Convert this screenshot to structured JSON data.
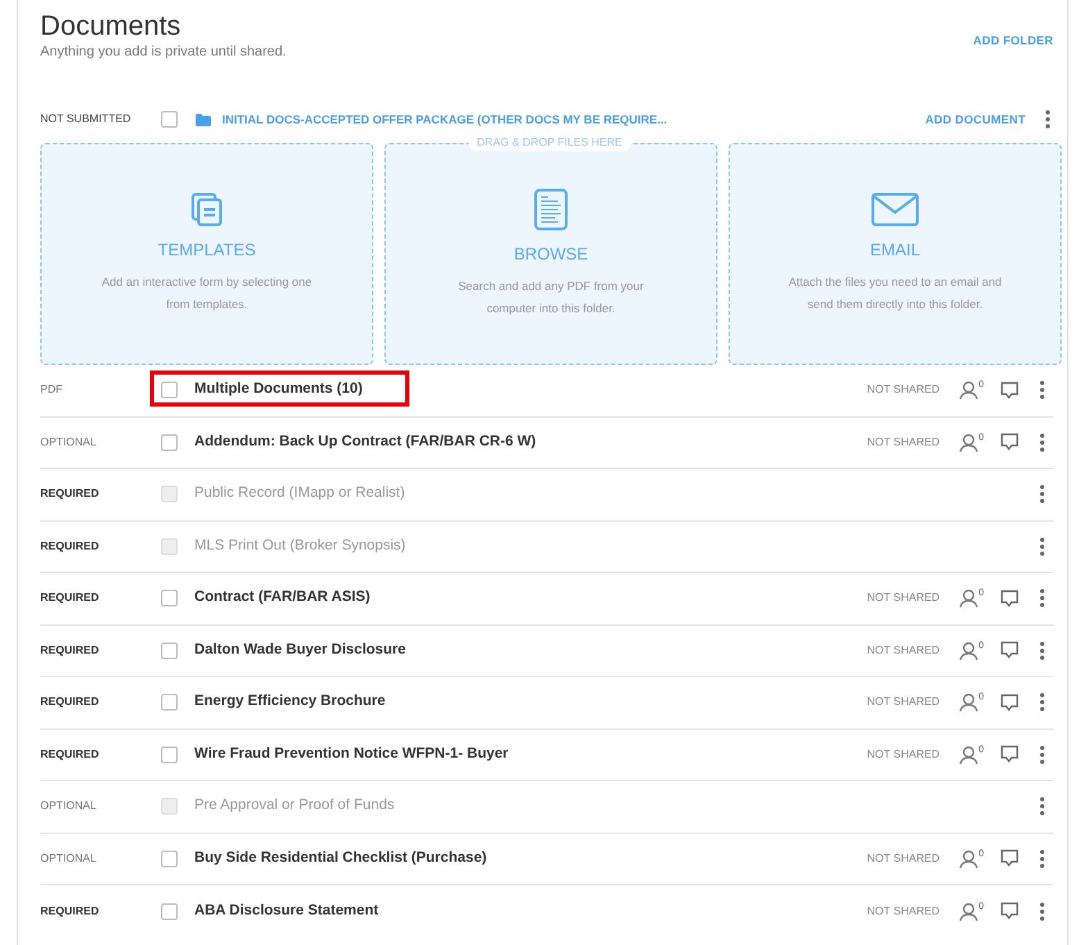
{
  "header": {
    "title": "Documents",
    "subtitle": "Anything you add is private until shared.",
    "action": "ADD FOLDER"
  },
  "folder": {
    "status": "NOT SUBMITTED",
    "checked": false,
    "name": "INITIAL DOCS-ACCEPTED OFFER PACKAGE (OTHER DOCS MY BE REQUIRE...",
    "action": "ADD DOCUMENT"
  },
  "dropzone": {
    "label": "DRAG & DROP FILES HERE",
    "options": [
      {
        "kind": "templates",
        "title": "TEMPLATES",
        "text": "Add an interactive form by selecting one from templates."
      },
      {
        "kind": "browse",
        "title": "BROWSE",
        "text": "Search and add any PDF from your computer into this folder."
      },
      {
        "kind": "email",
        "title": "EMAIL",
        "text": "Attach the files you need to an email and send them directly into this folder."
      }
    ]
  },
  "documents": [
    {
      "kind": "file",
      "tag": "PDF",
      "checked": false,
      "disabled": false,
      "highlighted": true,
      "name": "Multiple Documents (10)",
      "share_status": "NOT SHARED",
      "share_count": "0"
    },
    {
      "kind": "optional",
      "tag": "OPTIONAL",
      "checked": false,
      "disabled": false,
      "highlighted": false,
      "name": "Addendum: Back Up Contract (FAR/BAR CR-6 W)",
      "share_status": "NOT SHARED",
      "share_count": "0"
    },
    {
      "kind": "required",
      "tag": "REQUIRED",
      "checked": false,
      "disabled": true,
      "highlighted": false,
      "name": "Public Record (IMapp or Realist)"
    },
    {
      "kind": "required",
      "tag": "REQUIRED",
      "checked": false,
      "disabled": true,
      "highlighted": false,
      "name": "MLS Print Out (Broker Synopsis)"
    },
    {
      "kind": "required",
      "tag": "REQUIRED",
      "checked": false,
      "disabled": false,
      "highlighted": false,
      "name": "Contract (FAR/BAR ASIS)",
      "share_status": "NOT SHARED",
      "share_count": "0"
    },
    {
      "kind": "required",
      "tag": "REQUIRED",
      "checked": false,
      "disabled": false,
      "highlighted": false,
      "name": "Dalton Wade Buyer Disclosure",
      "share_status": "NOT SHARED",
      "share_count": "0"
    },
    {
      "kind": "required",
      "tag": "REQUIRED",
      "checked": false,
      "disabled": false,
      "highlighted": false,
      "name": "Energy Efficiency Brochure",
      "share_status": "NOT SHARED",
      "share_count": "0"
    },
    {
      "kind": "required",
      "tag": "REQUIRED",
      "checked": false,
      "disabled": false,
      "highlighted": false,
      "name": "Wire Fraud Prevention Notice WFPN-1- Buyer",
      "share_status": "NOT SHARED",
      "share_count": "0"
    },
    {
      "kind": "optional",
      "tag": "OPTIONAL",
      "checked": false,
      "disabled": true,
      "highlighted": false,
      "name": "Pre Approval or Proof of Funds"
    },
    {
      "kind": "optional",
      "tag": "OPTIONAL",
      "checked": false,
      "disabled": false,
      "highlighted": false,
      "name": "Buy Side Residential Checklist (Purchase)",
      "share_status": "NOT SHARED",
      "share_count": "0"
    },
    {
      "kind": "required",
      "tag": "REQUIRED",
      "checked": false,
      "disabled": false,
      "highlighted": false,
      "name": "ABA Disclosure Statement",
      "share_status": "NOT SHARED",
      "share_count": "0"
    }
  ]
}
